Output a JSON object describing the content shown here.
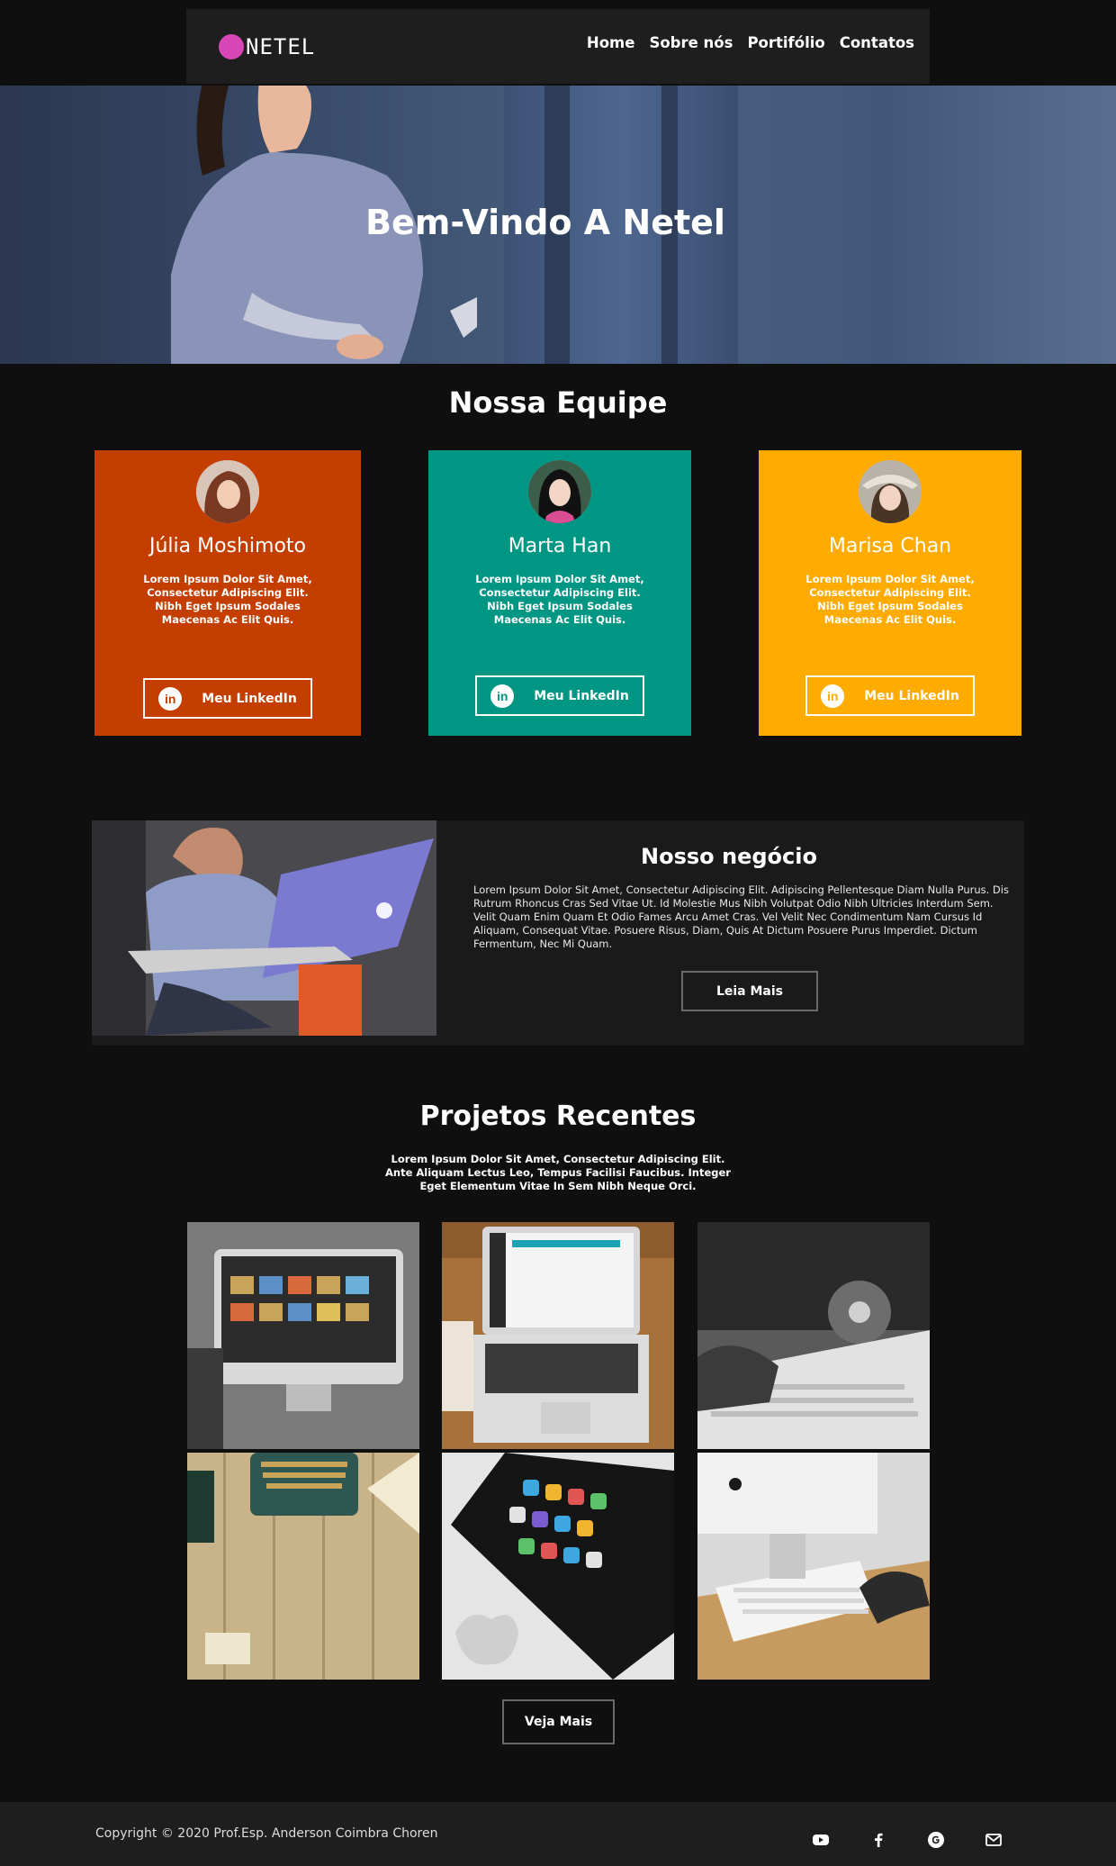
{
  "brand": {
    "logo_text": "NETEL",
    "logo_color": "#d946b6"
  },
  "nav": {
    "items": [
      "Home",
      "Sobre nós",
      "Portifólio",
      "Contatos"
    ]
  },
  "hero": {
    "title": "Bem-Vindo A Netel"
  },
  "team": {
    "title": "Nossa Equipe",
    "members": [
      {
        "name": "Júlia Moshimoto",
        "bio": "Lorem Ipsum Dolor Sit Amet, Consectetur Adipiscing Elit. Nibh Eget Ipsum Sodales Maecenas Ac Elit Quis.",
        "button": "Meu LinkedIn",
        "color": "#c43e00"
      },
      {
        "name": "Marta Han",
        "bio": "Lorem Ipsum Dolor Sit Amet, Consectetur Adipiscing Elit. Nibh Eget Ipsum Sodales Maecenas Ac Elit Quis.",
        "button": "Meu LinkedIn",
        "color": "#009684"
      },
      {
        "name": "Marisa Chan",
        "bio": "Lorem Ipsum Dolor Sit Amet, Consectetur Adipiscing Elit. Nibh Eget Ipsum Sodales Maecenas Ac Elit Quis.",
        "button": "Meu LinkedIn",
        "color": "#ffab00"
      }
    ]
  },
  "business": {
    "title": "Nosso negócio",
    "text": "Lorem Ipsum Dolor Sit Amet, Consectetur Adipiscing Elit. Adipiscing Pellentesque Diam Nulla Purus. Dis Rutrum Rhoncus Cras Sed Vitae Ut. Id Molestie Mus Nibh Volutpat Odio Nibh Ultricies Interdum Sem. Velit Quam Enim Quam Et Odio Fames Arcu Amet Cras. Vel Velit Nec Condimentum Nam Cursus Id Aliquam, Consequat Vitae. Posuere Risus, Diam, Quis At Dictum Posuere Purus Imperdiet. Dictum Fermentum, Nec Mi Quam.",
    "button": "Leia Mais"
  },
  "projects": {
    "title": "Projetos Recentes",
    "subtitle": "Lorem Ipsum Dolor Sit Amet, Consectetur Adipiscing Elit. Ante Aliquam Lectus Leo, Tempus Facilisi Faucibus. Integer Eget Elementum Vitae In Sem Nibh Neque Orci.",
    "button": "Veja Mais"
  },
  "footer": {
    "copyright": "Copyright © 2020 Prof.Esp. Anderson Coimbra Choren",
    "socials": [
      "youtube-icon",
      "facebook-icon",
      "google-icon",
      "mail-icon"
    ]
  }
}
